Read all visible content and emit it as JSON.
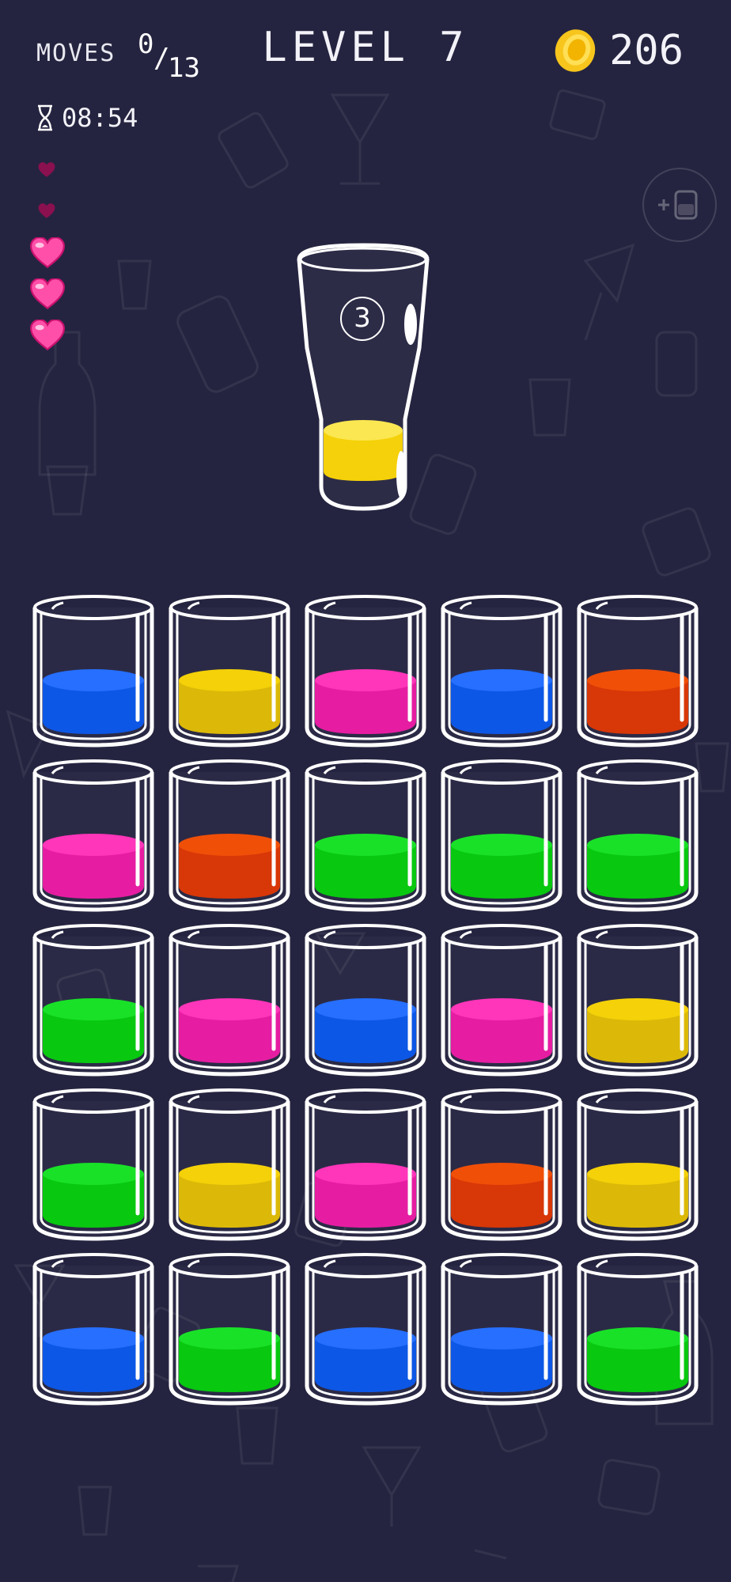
{
  "hud": {
    "moves_label": "MOVES",
    "moves_current": "0",
    "moves_slash": "/",
    "moves_max": "13",
    "level_title": "LEVEL 7",
    "coins": "206",
    "timer": "08:54"
  },
  "icons": {
    "coin": "coin-icon",
    "hourglass": "hourglass-icon",
    "heart": "heart-icon",
    "add_tube": "add-tube-icon"
  },
  "lives": {
    "total": 5,
    "remaining": 3
  },
  "featured_glass": {
    "number": "3",
    "liquid": "yellow",
    "fill_fraction": 0.33
  },
  "colors": {
    "blue": "#1f6bff",
    "yellow": "#f4d000",
    "pink": "#ff2fb8",
    "orange": "#f04a00",
    "green": "#12e022",
    "background": "#252440",
    "heart_full": "#ff4fa8",
    "heart_empty": "#8a1050",
    "coin": "#f7c51c"
  },
  "grid": [
    [
      "blue",
      "yellow",
      "pink",
      "blue",
      "orange"
    ],
    [
      "pink",
      "orange",
      "green",
      "green",
      "green"
    ],
    [
      "green",
      "pink",
      "blue",
      "pink",
      "yellow"
    ],
    [
      "green",
      "yellow",
      "pink",
      "orange",
      "yellow"
    ],
    [
      "blue",
      "green",
      "blue",
      "blue",
      "green"
    ]
  ]
}
